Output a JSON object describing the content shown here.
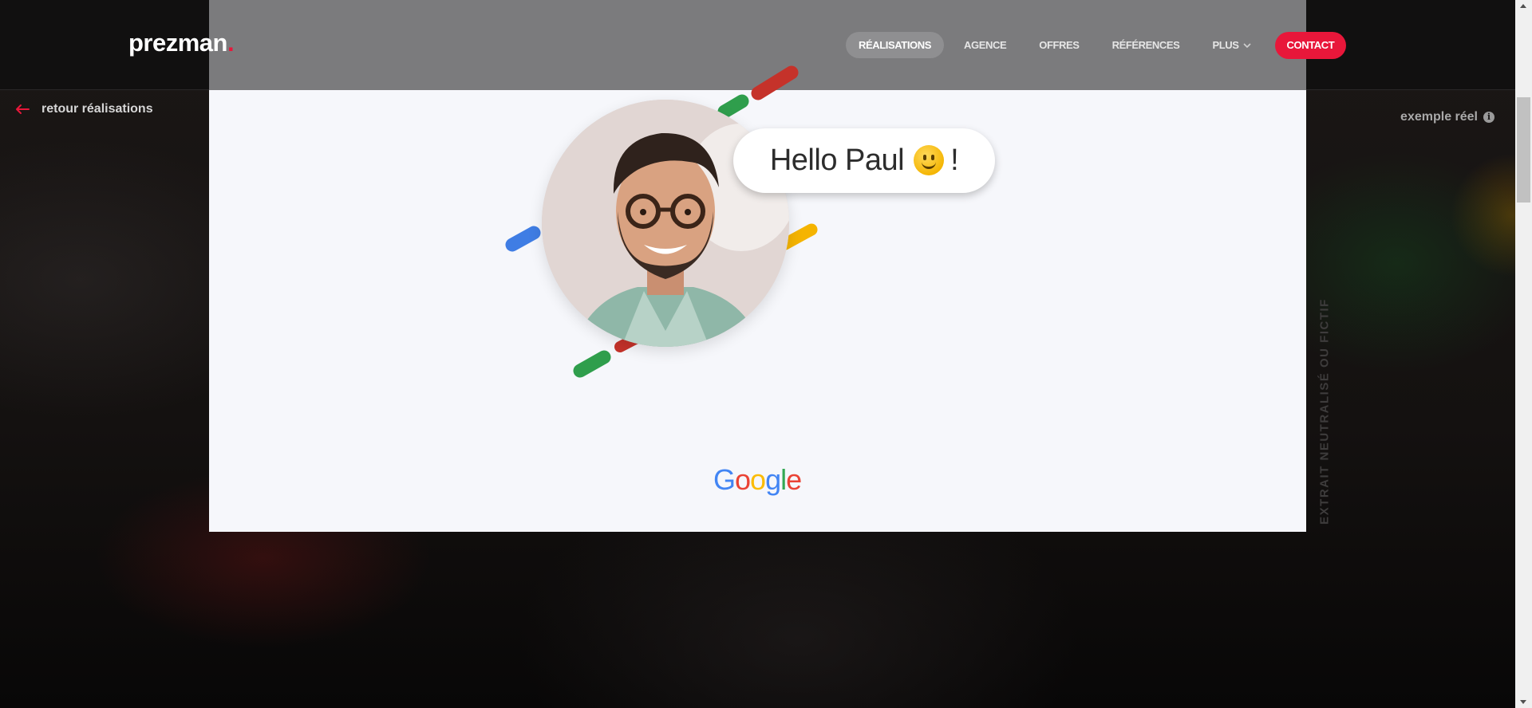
{
  "header": {
    "logo": {
      "text": "prezman",
      "dot": "."
    },
    "nav": [
      {
        "label": "RÉALISATIONS",
        "active": true
      },
      {
        "label": "AGENCE",
        "active": false
      },
      {
        "label": "OFFRES",
        "active": false
      },
      {
        "label": "RÉFÉRENCES",
        "active": false
      },
      {
        "label": "PLUS",
        "active": false,
        "dropdown": true,
        "icon": "chevron-down-icon"
      }
    ],
    "contact_label": "CONTACT"
  },
  "back_link": {
    "label": "retour réalisations",
    "icon": "arrow-left-icon"
  },
  "real_example": {
    "label": "exemple réel",
    "icon": "info-icon",
    "icon_glyph": "i"
  },
  "side_label": "EXTRAIT NEUTRALISÉ OU FICTIF",
  "slide": {
    "greeting_name": "Hello Paul",
    "greeting_end": "!",
    "emoji": "slightly-smiling-face-icon",
    "brand_letters": [
      "G",
      "o",
      "o",
      "g",
      "l",
      "e"
    ]
  },
  "colors": {
    "accent": "#e8173a",
    "google_blue": "#4285f4",
    "google_red": "#ea4335",
    "google_yellow": "#fbbc05",
    "google_green": "#34a853"
  }
}
